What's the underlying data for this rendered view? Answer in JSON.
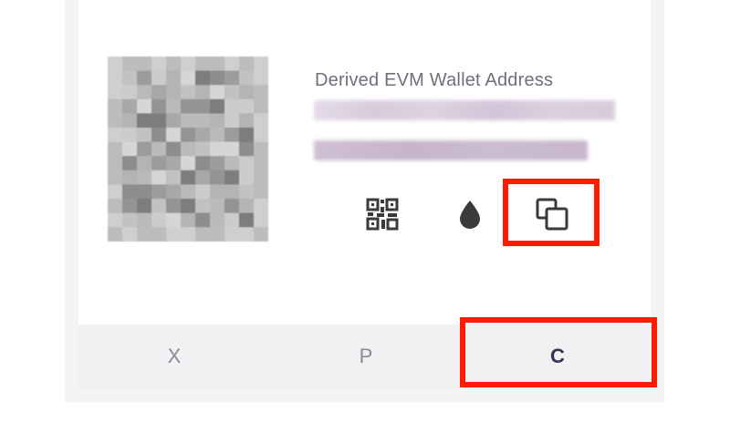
{
  "wallet": {
    "address_label": "Derived EVM Wallet Address",
    "address_value": ""
  },
  "actions": {
    "qr_icon": "qr-code-icon",
    "faucet_icon": "water-drop-icon",
    "copy_icon": "copy-icon"
  },
  "tabs": [
    {
      "label": "X",
      "active": false
    },
    {
      "label": "P",
      "active": false
    },
    {
      "label": "C",
      "active": true
    }
  ],
  "colors": {
    "highlight": "#ff1a00",
    "active_tab_text": "#3b2f52",
    "inactive_tab_text": "#8a8a93",
    "icon": "#3a3a3a"
  }
}
